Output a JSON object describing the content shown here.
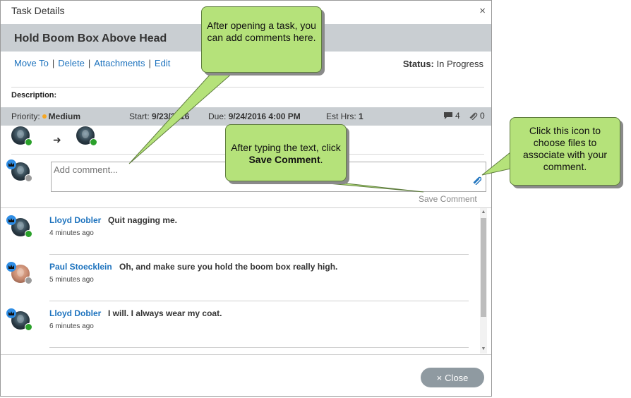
{
  "dialog": {
    "title": "Task Details",
    "close_glyph": "×",
    "task_name": "Hold Boom Box Above Head",
    "actions": [
      "Move To",
      "Delete",
      "Attachments",
      "Edit"
    ],
    "action_separator": "|",
    "status_label": "Status:",
    "status_value": "In Progress",
    "description_label": "Description:",
    "priority_label": "Priority:",
    "priority_value": "Medium",
    "priority_color": "#f5a623",
    "start_label": "Start:",
    "start_value": "9/23/2016",
    "due_label": "Due:",
    "due_value": "9/24/2016 4:00 PM",
    "est_label": "Est Hrs:",
    "est_value": "1",
    "comment_count": "4",
    "attachment_count": "0",
    "assignment_arrow": "➜",
    "comment_placeholder": "Add comment...",
    "save_comment_label": "Save Comment",
    "close_label": "Close",
    "close_icon": "×"
  },
  "comments": [
    {
      "author": "Lloyd Dobler",
      "text": "Quit nagging me.",
      "time": "4 minutes ago",
      "presence": "online"
    },
    {
      "author": "Paul Stoecklein",
      "text": "Oh, and make sure you hold the boom box really high.",
      "time": "5 minutes ago",
      "presence": "offline"
    },
    {
      "author": "Lloyd Dobler",
      "text": "I will. I always wear my coat.",
      "time": "6 minutes ago",
      "presence": "online"
    }
  ],
  "callouts": {
    "add_comment": "After opening a task, you can add comments here.",
    "save_prefix": "After typing the text, click",
    "save_bold": "Save Comment",
    "save_suffix": ".",
    "attach": "Click this icon to choose files to associate with your comment."
  },
  "colors": {
    "link": "#1e73be",
    "header_bar": "#c9ced2",
    "callout_fill": "#b5e27a",
    "online": "#2aa02a",
    "role_badge": "#2f8de4"
  }
}
